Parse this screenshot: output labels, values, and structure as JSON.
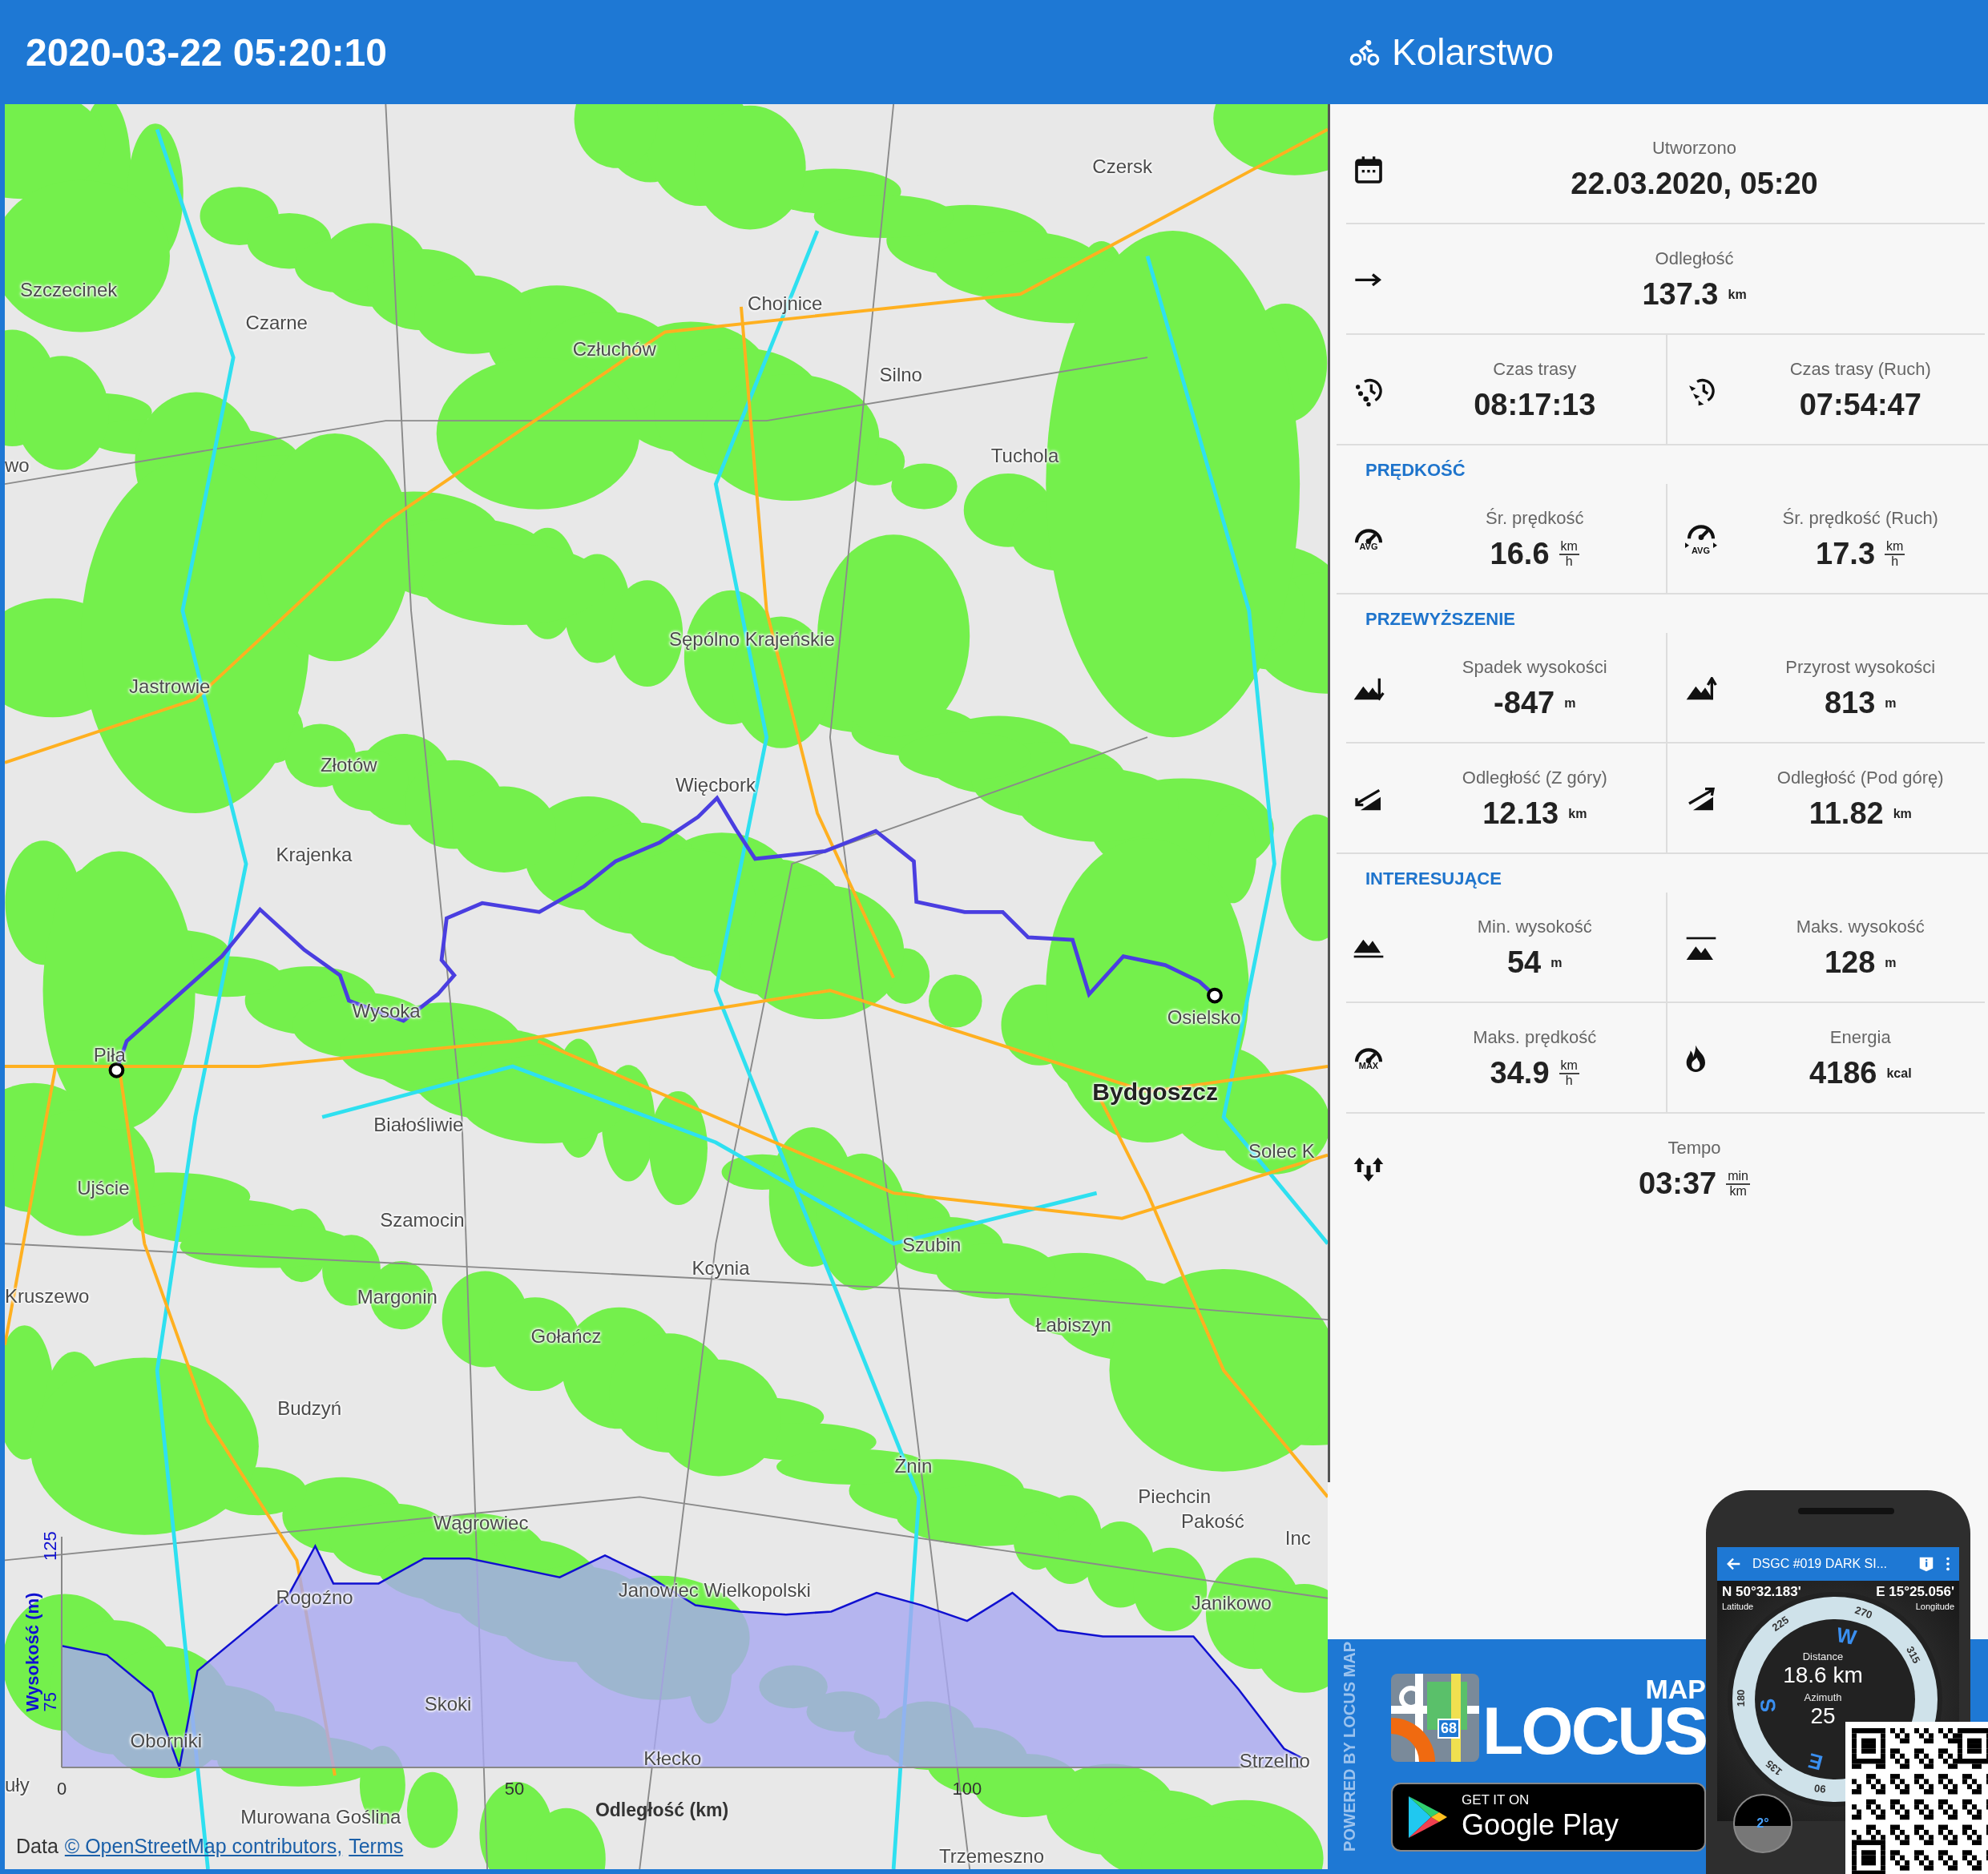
{
  "header": {
    "title": "2020-03-22 05:20:10",
    "activity": "Kolarstwo"
  },
  "map": {
    "places": [
      {
        "name": "Czersk",
        "kind": "town"
      },
      {
        "name": "Szczecinek",
        "kind": "town"
      },
      {
        "name": "Czarne",
        "kind": "town"
      },
      {
        "name": "Chojnice",
        "kind": "town"
      },
      {
        "name": "Człuchów",
        "kind": "town"
      },
      {
        "name": "Silno",
        "kind": "town"
      },
      {
        "name": "Tuchola",
        "kind": "town"
      },
      {
        "name": "wo",
        "kind": "town"
      },
      {
        "name": "Sępólno Krajeńskie",
        "kind": "town"
      },
      {
        "name": "Jastrowie",
        "kind": "town"
      },
      {
        "name": "Złotów",
        "kind": "town"
      },
      {
        "name": "Więcbork",
        "kind": "town"
      },
      {
        "name": "Krajenka",
        "kind": "town"
      },
      {
        "name": "Wysoka",
        "kind": "town"
      },
      {
        "name": "Osielsko",
        "kind": "town"
      },
      {
        "name": "Piła",
        "kind": "town"
      },
      {
        "name": "Bydgoszcz",
        "kind": "city"
      },
      {
        "name": "Białośliwie",
        "kind": "town"
      },
      {
        "name": "Solec K",
        "kind": "town"
      },
      {
        "name": "Ujście",
        "kind": "town"
      },
      {
        "name": "Szamocin",
        "kind": "town"
      },
      {
        "name": "Kcynia",
        "kind": "town"
      },
      {
        "name": "Szubin",
        "kind": "town"
      },
      {
        "name": "Kruszewo",
        "kind": "town"
      },
      {
        "name": "Margonin",
        "kind": "town"
      },
      {
        "name": "Gołańcz",
        "kind": "town"
      },
      {
        "name": "Łabiszyn",
        "kind": "town"
      },
      {
        "name": "Budzyń",
        "kind": "town"
      },
      {
        "name": "Żnin",
        "kind": "town"
      },
      {
        "name": "Piechcin",
        "kind": "town"
      },
      {
        "name": "Pakość",
        "kind": "town"
      },
      {
        "name": "Wągrowiec",
        "kind": "town"
      },
      {
        "name": "Inc",
        "kind": "town"
      },
      {
        "name": "Rogoźno",
        "kind": "town"
      },
      {
        "name": "Janowiec Wielkopolski",
        "kind": "town"
      },
      {
        "name": "Janikowo",
        "kind": "town"
      },
      {
        "name": "Skoki",
        "kind": "town"
      },
      {
        "name": "Oborniki",
        "kind": "town"
      },
      {
        "name": "Kłecko",
        "kind": "town"
      },
      {
        "name": "Strzelno",
        "kind": "town"
      },
      {
        "name": "uły",
        "kind": "town"
      },
      {
        "name": "Murowana Goślina",
        "kind": "town"
      },
      {
        "name": "Trzemeszno",
        "kind": "town"
      }
    ],
    "elevation_chart": {
      "chart_data": {
        "type": "area",
        "xlabel": "Odległość (km)",
        "ylabel": "Wysokość (m)",
        "x": [
          0,
          5,
          10,
          13,
          15,
          20,
          25,
          28,
          30,
          35,
          40,
          45,
          50,
          55,
          60,
          65,
          70,
          75,
          80,
          85,
          90,
          95,
          100,
          105,
          110,
          115,
          120,
          125,
          130,
          135,
          137
        ],
        "series": [
          {
            "color": "#1010d0",
            "values": [
              93,
              90,
              78,
              54,
              85,
              97,
              109,
              125,
              113,
              113,
              121,
              121,
              118,
              115,
              122,
              115,
              106,
              104,
              103,
              104,
              110,
              106,
              101,
              110,
              98,
              96,
              96,
              96,
              79,
              60,
              57
            ]
          }
        ],
        "xlim": [
          0,
          137
        ],
        "ylim": [
          54,
          128
        ],
        "xticks": [
          0,
          50,
          100
        ],
        "yticks": [
          75,
          125
        ]
      }
    },
    "attribution": [
      {
        "kind": "text",
        "text": "Data"
      },
      {
        "kind": "link",
        "text": "© OpenStreetMap contributors,"
      },
      {
        "kind": "link",
        "text": "Terms"
      }
    ]
  },
  "stats": {
    "sections": [
      {
        "rows": [
          [
            {
              "label": "Utworzono",
              "value": "22.03.2020, 05:20"
            }
          ],
          [
            {
              "label": "Odległość",
              "value": "137.3",
              "unit": "km"
            }
          ],
          [
            {
              "label": "Czas trasy",
              "value": "08:17:13"
            },
            {
              "label": "Czas trasy (Ruch)",
              "value": "07:54:47"
            }
          ]
        ]
      },
      {
        "heading": "PRĘDKOŚĆ",
        "rows": [
          [
            {
              "icon_text": "AVG",
              "label": "Śr. prędkość",
              "value": "16.6",
              "unit_top": "km",
              "unit_bottom": "h"
            },
            {
              "icon_text": "AVG",
              "label": "Śr. prędkość (Ruch)",
              "value": "17.3",
              "unit_top": "km",
              "unit_bottom": "h"
            }
          ]
        ]
      },
      {
        "heading": "PRZEWYŻSZENIE",
        "rows": [
          [
            {
              "label": "Spadek wysokości",
              "value": "-847",
              "unit": "m"
            },
            {
              "label": "Przyrost wysokości",
              "value": "813",
              "unit": "m"
            }
          ],
          [
            {
              "label": "Odległość (Z góry)",
              "value": "12.13",
              "unit": "km"
            },
            {
              "label": "Odległość (Pod górę)",
              "value": "11.82",
              "unit": "km"
            }
          ]
        ]
      },
      {
        "heading": "INTERESUJĄCE",
        "rows": [
          [
            {
              "label": "Min. wysokość",
              "value": "54",
              "unit": "m"
            },
            {
              "label": "Maks. wysokość",
              "value": "128",
              "unit": "m"
            }
          ],
          [
            {
              "icon_text": "MAX",
              "label": "Maks. prędkość",
              "value": "34.9",
              "unit_top": "km",
              "unit_bottom": "h"
            },
            {
              "label": "Energia",
              "value": "4186",
              "unit": "kcal"
            }
          ],
          [
            {
              "label": "Tempo",
              "value": "03:37",
              "unit_top": "min",
              "unit_bottom": "km"
            }
          ]
        ]
      }
    ]
  },
  "ad": {
    "powered_by": "POWERED BY LOCUS MAP",
    "logo_badge": "68",
    "logo_small": "MAP",
    "logo": "LOCUS",
    "store_small": "GET IT ON",
    "store": "Google Play",
    "phone": {
      "title": "DSGC #019 DARK SI...",
      "lat": "N 50°32.183'",
      "lat_label": "Latitude",
      "lon": "E 15°25.056'",
      "lon_label": "Longitude",
      "dial": [
        "270",
        "225",
        "315",
        "180",
        "135",
        "90"
      ],
      "cardinals": [
        "W",
        "S",
        "E"
      ],
      "distance_label": "Distance",
      "distance": "18.6 km",
      "azimuth_label": "Azimuth",
      "azimuth": "25",
      "tilt": "2°"
    }
  }
}
